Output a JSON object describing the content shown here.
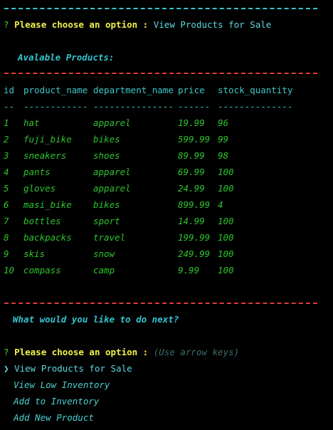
{
  "colors": {
    "background": "#000000",
    "cyan_rule": "#35c3cf",
    "red_rule": "#e2383a",
    "prompt_yellow": "#f2f24a",
    "question_green": "#4ec94e",
    "row_green": "#2ec32e"
  },
  "prompt1": {
    "qmark": "?",
    "label": "Please choose an option :",
    "answer": "View Products for Sale"
  },
  "available_heading": "Avalable Products:",
  "table": {
    "headers": [
      "id",
      "product_name",
      "department_name",
      "price",
      "stock_quantity"
    ],
    "separators": [
      "--",
      "------------",
      "---------------",
      "------",
      "--------------"
    ],
    "rows": [
      [
        "1",
        "hat",
        "apparel",
        "19.99",
        "96"
      ],
      [
        "2",
        "fuji_bike",
        "bikes",
        "599.99",
        "99"
      ],
      [
        "3",
        "sneakers",
        "shoes",
        "89.99",
        "98"
      ],
      [
        "4",
        "pants",
        "apparel",
        "69.99",
        "100"
      ],
      [
        "5",
        "gloves",
        "apparel",
        "24.99",
        "100"
      ],
      [
        "6",
        "masi_bike",
        "bikes",
        "899.99",
        "4"
      ],
      [
        "7",
        "bottles",
        "sport",
        "14.99",
        "100"
      ],
      [
        "8",
        "backpacks",
        "travel",
        "199.99",
        "100"
      ],
      [
        "9",
        "skis",
        "snow",
        "249.99",
        "100"
      ],
      [
        "10",
        "compass",
        "camp",
        "9.99",
        "100"
      ]
    ]
  },
  "next_question": "What would you like to do next?",
  "prompt2": {
    "qmark": "?",
    "label": "Please choose an option :",
    "hint": "(Use arrow keys)"
  },
  "menu": {
    "pointer": "❯",
    "items": [
      "View Products for Sale",
      "View Low Inventory",
      "Add to Inventory",
      "Add New Product"
    ],
    "selected_index": 0
  }
}
